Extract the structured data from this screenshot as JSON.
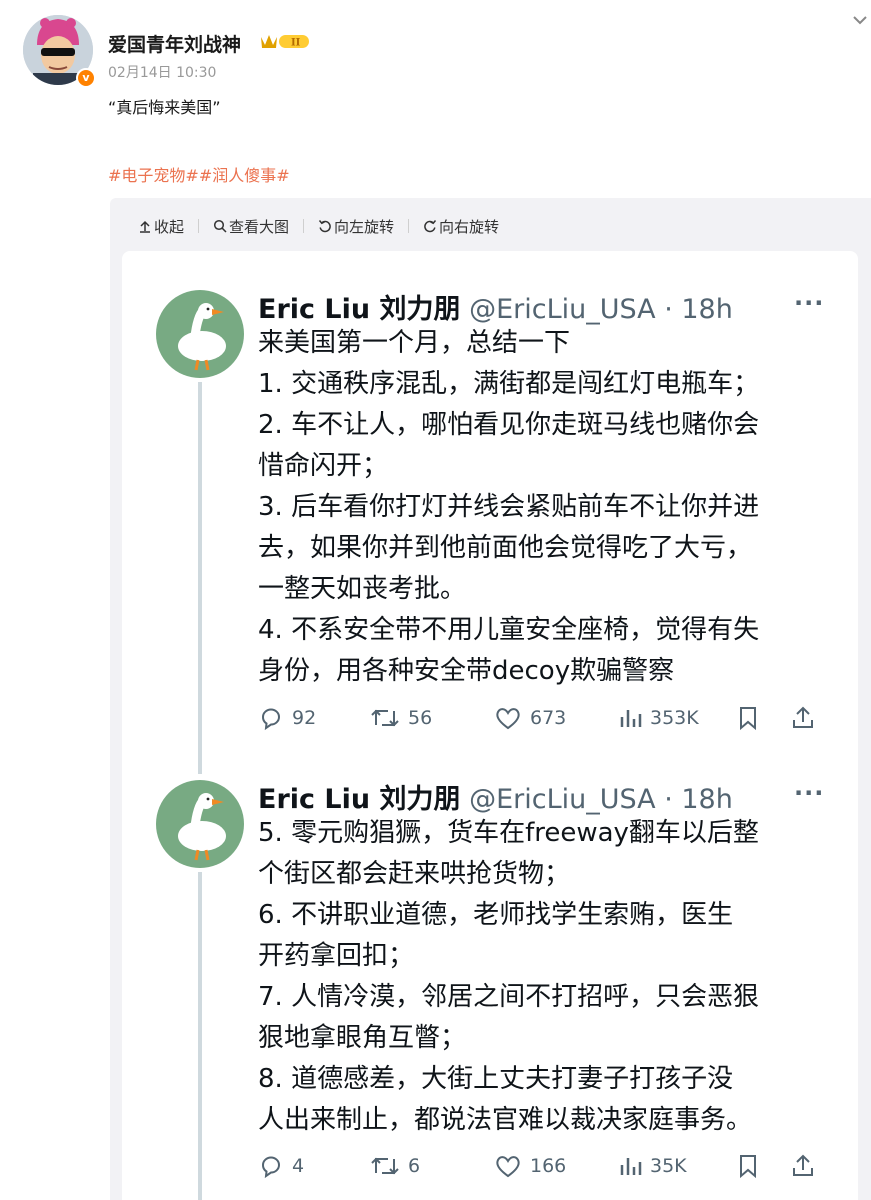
{
  "post": {
    "username": "爱国青年刘战神",
    "rank_badge": "II",
    "timestamp": "02月14日 10:30",
    "text": "“真后悔来美国”",
    "hashtags": "#电子宠物##润人傻事#",
    "verified_mark": "v"
  },
  "viewer_toolbar": {
    "collapse": "收起",
    "view_large": "查看大图",
    "rotate_left": "向左旋转",
    "rotate_right": "向右旋转"
  },
  "tweets": [
    {
      "name": "Eric Liu 刘力朋",
      "handle": "@EricLiu_USA · 18h",
      "more": "···",
      "lines": [
        "来美国第一个月，总结一下",
        "1. 交通秩序混乱，满街都是闯红灯电瓶车；",
        "2. 车不让人，哪怕看见你走斑马线也赌你会",
        "惜命闪开；",
        "3. 后车看你打灯并线会紧贴前车不让你并进",
        "去，如果你并到他前面他会觉得吃了大亏，",
        "一整天如丧考批。",
        "4. 不系安全带不用儿童安全座椅，觉得有失",
        "身份，用各种安全带decoy欺骗警察"
      ],
      "replies": "92",
      "retweets": "56",
      "likes": "673",
      "views": "353K"
    },
    {
      "name": "Eric Liu 刘力朋",
      "handle": "@EricLiu_USA · 18h",
      "more": "···",
      "lines": [
        "5. 零元购猖獗，货车在freeway翻车以后整",
        "个街区都会赶来哄抢货物；",
        "6. 不讲职业道德，老师找学生索贿，医生",
        "开药拿回扣；",
        "7. 人情冷漠，邻居之间不打招呼，只会恶狠",
        "狠地拿眼角互瞥；",
        "8. 道德感差，大街上丈夫打妻子打孩子没",
        "人出来制止，都说法官难以裁决家庭事务。"
      ],
      "replies": "4",
      "retweets": "6",
      "likes": "166",
      "views": "35K"
    }
  ],
  "colors": {
    "hashtag": "#eb7350",
    "badge_orange": "#ff8200",
    "goose_bg": "#78aa83",
    "twitter_gray": "#536471"
  }
}
